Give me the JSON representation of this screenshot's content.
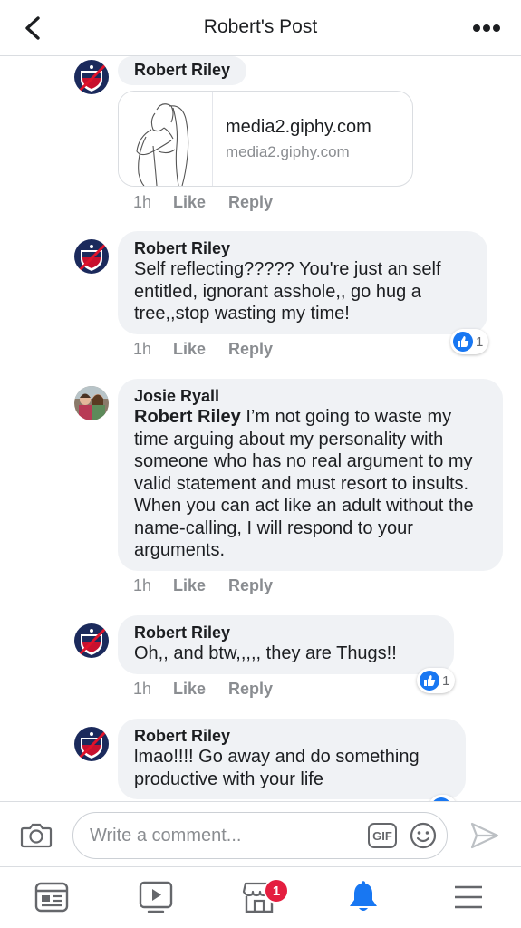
{
  "header": {
    "title": "Robert's Post",
    "back_icon": "back-chevron-icon",
    "more_icon": "more-dots-icon"
  },
  "comments": [
    {
      "author": "Robert Riley",
      "link": {
        "title": "media2.giphy.com",
        "domain": "media2.giphy.com"
      },
      "time": "1h",
      "like": "Like",
      "reply": "Reply"
    },
    {
      "author": "Robert Riley",
      "text": "Self reflecting????? You're just an self entitled, ignorant asshole,, go hug a tree,,stop wasting my time!",
      "time": "1h",
      "like": "Like",
      "reply": "Reply",
      "reactions": "1"
    },
    {
      "author": "Josie Ryall",
      "mention": "Robert Riley",
      "text": " I’m not going to waste my time arguing about my personality with someone who has no real argument to my valid statement and must resort to insults. When you can act like an adult without the name-calling, I will respond to your arguments.",
      "time": "1h",
      "like": "Like",
      "reply": "Reply"
    },
    {
      "author": "Robert Riley",
      "text": "Oh,,  and btw,,,,,  they are Thugs!!",
      "time": "1h",
      "like": "Like",
      "reply": "Reply",
      "reactions": "1"
    },
    {
      "author": "Robert Riley",
      "text": "lmao!!!! Go away and do something productive with your life"
    }
  ],
  "composer": {
    "placeholder": "Write a comment...",
    "gif_label": "GIF"
  },
  "tabbar": {
    "marketplace_badge": "1"
  },
  "colors": {
    "accent": "#1877f2",
    "bubble": "#f0f2f5",
    "badge": "#e41e3f",
    "muted_text": "#8a8d91"
  }
}
